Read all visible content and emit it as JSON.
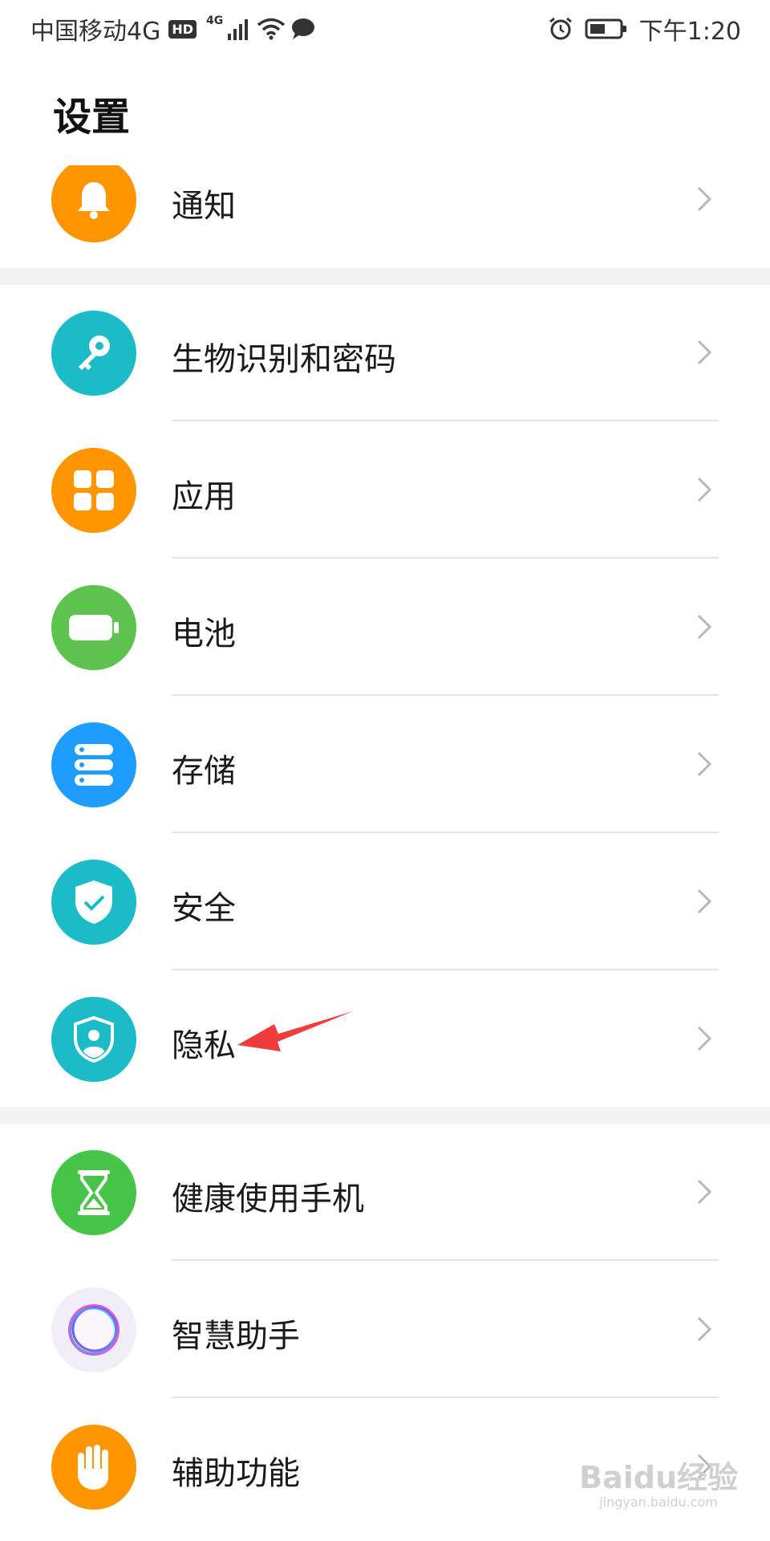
{
  "status_bar": {
    "carrier": "中国移动4G",
    "hd_badge": "HD",
    "network_type": "4G",
    "time": "下午1:20"
  },
  "page": {
    "title": "设置"
  },
  "sections": [
    {
      "items": [
        {
          "label": "通知",
          "icon": "bell-icon",
          "color": "#FF9500"
        }
      ]
    },
    {
      "items": [
        {
          "label": "生物识别和密码",
          "icon": "key-icon",
          "color": "#1BBCC7"
        },
        {
          "label": "应用",
          "icon": "apps-grid-icon",
          "color": "#FF9500"
        },
        {
          "label": "电池",
          "icon": "battery-icon",
          "color": "#5DC24E"
        },
        {
          "label": "存储",
          "icon": "storage-icon",
          "color": "#1E9CFF"
        },
        {
          "label": "安全",
          "icon": "shield-check-icon",
          "color": "#1BBCC7"
        },
        {
          "label": "隐私",
          "icon": "privacy-shield-icon",
          "color": "#1BBCC7"
        }
      ]
    },
    {
      "items": [
        {
          "label": "健康使用手机",
          "icon": "hourglass-icon",
          "color": "#46C548"
        },
        {
          "label": "智慧助手",
          "icon": "assistant-ring-icon",
          "color": "#F1EEF8"
        },
        {
          "label": "辅助功能",
          "icon": "hand-icon",
          "color": "#FF9500"
        }
      ]
    }
  ],
  "annotation": {
    "type": "red-arrow",
    "points_to": "隐私",
    "color": "#F03C3C"
  },
  "watermark": {
    "text": "Baidu经验",
    "sub": "jingyan.baidu.com"
  }
}
